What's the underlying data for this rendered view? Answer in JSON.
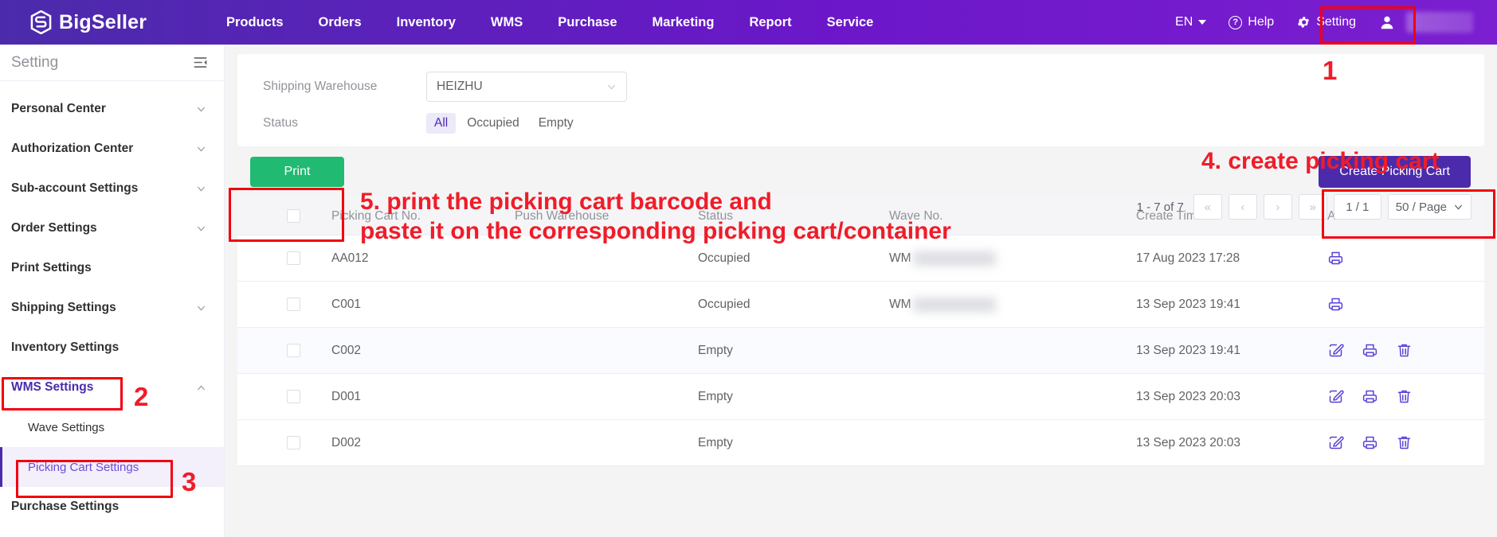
{
  "header": {
    "brand": "BigSeller",
    "nav": [
      {
        "label": "Products"
      },
      {
        "label": "Orders"
      },
      {
        "label": "Inventory"
      },
      {
        "label": "WMS"
      },
      {
        "label": "Purchase"
      },
      {
        "label": "Marketing"
      },
      {
        "label": "Report"
      },
      {
        "label": "Service"
      }
    ],
    "language": "EN",
    "help": "Help",
    "setting": "Setting"
  },
  "sidebar": {
    "title": "Setting",
    "items": [
      {
        "label": "Personal Center",
        "expandable": true
      },
      {
        "label": "Authorization Center",
        "expandable": true
      },
      {
        "label": "Sub-account Settings",
        "expandable": true
      },
      {
        "label": "Order Settings",
        "expandable": true
      },
      {
        "label": "Print Settings",
        "expandable": false
      },
      {
        "label": "Shipping Settings",
        "expandable": true
      },
      {
        "label": "Inventory Settings",
        "expandable": false
      },
      {
        "label": "WMS Settings",
        "expandable": true
      },
      {
        "label": "Wave Settings",
        "expandable": false
      },
      {
        "label": "Picking Cart Settings",
        "expandable": false
      },
      {
        "label": "Purchase Settings",
        "expandable": false
      }
    ]
  },
  "filters": {
    "warehouse_label": "Shipping Warehouse",
    "warehouse_value": "HEIZHU",
    "status_label": "Status",
    "status_tabs": [
      "All",
      "Occupied",
      "Empty"
    ],
    "status_selected": "All"
  },
  "toolbar": {
    "print_label": "Print",
    "create_label": "Create Picking Cart"
  },
  "pagination": {
    "count": "1 - 7 of 7",
    "first": "«",
    "prev": "‹",
    "next": "›",
    "last": "»",
    "page": "1 / 1",
    "page_size": "50 / Page"
  },
  "table": {
    "columns": [
      "Picking Cart No.",
      "Push Warehouse",
      "Status",
      "Wave No.",
      "Create Time",
      "Actions"
    ],
    "rows": [
      {
        "cart_no": "AA012",
        "push_warehouse": "",
        "status": "Occupied",
        "wave_no": "WM",
        "create_time": "17 Aug 2023 17:28",
        "actions": [
          "print"
        ]
      },
      {
        "cart_no": "C001",
        "push_warehouse": "",
        "status": "Occupied",
        "wave_no": "WM",
        "create_time": "13 Sep 2023 19:41",
        "actions": [
          "print"
        ]
      },
      {
        "cart_no": "C002",
        "push_warehouse": "",
        "status": "Empty",
        "wave_no": "",
        "create_time": "13 Sep 2023 19:41",
        "actions": [
          "edit",
          "print",
          "delete"
        ]
      },
      {
        "cart_no": "D001",
        "push_warehouse": "",
        "status": "Empty",
        "wave_no": "",
        "create_time": "13 Sep 2023 20:03",
        "actions": [
          "edit",
          "print",
          "delete"
        ]
      },
      {
        "cart_no": "D002",
        "push_warehouse": "",
        "status": "Empty",
        "wave_no": "",
        "create_time": "13 Sep 2023 20:03",
        "actions": [
          "edit",
          "print",
          "delete"
        ]
      }
    ]
  },
  "annotations": {
    "step1": "1",
    "step2": "2",
    "step3": "3",
    "step4": "4. create picking cart",
    "step5": "5. print the picking cart barcode and\npaste it on the corresponding picking cart/container"
  },
  "colors": {
    "brand_purple": "#4b2bab",
    "header_gradient_end": "#7b1fd0",
    "print_green": "#21ba72",
    "annotation_red": "#f2000f"
  }
}
